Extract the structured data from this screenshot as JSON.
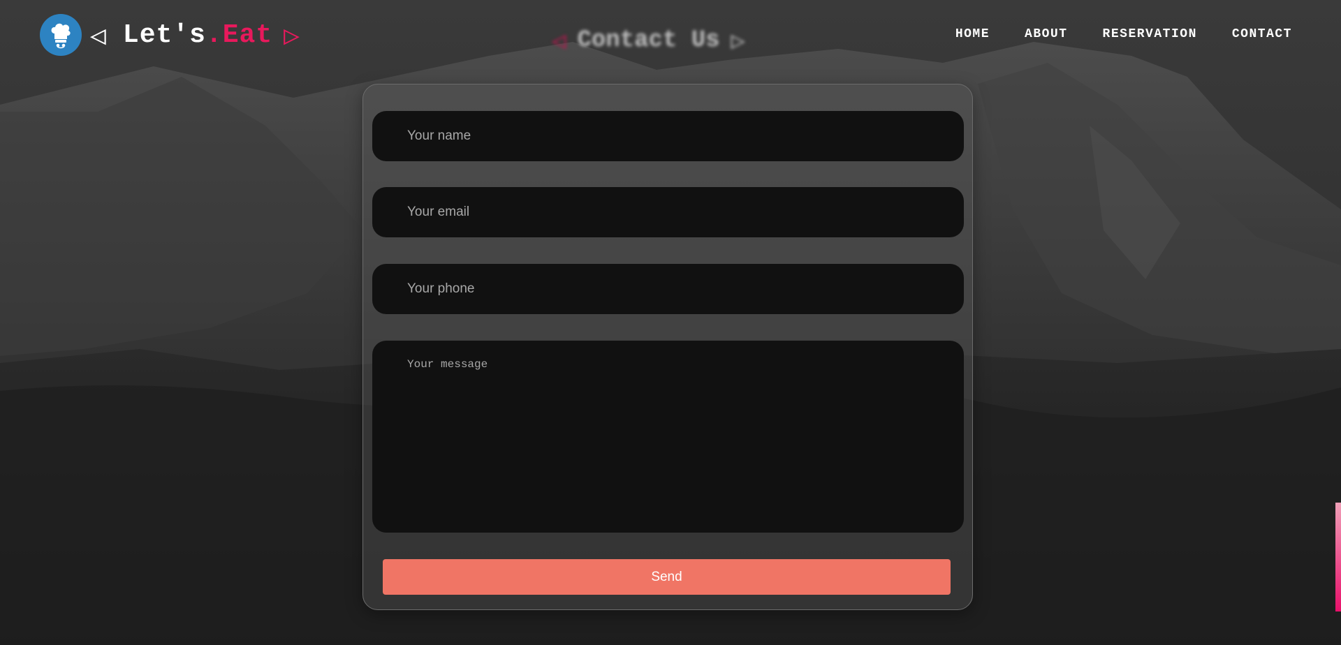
{
  "brand": {
    "arrow_left": "◁",
    "name": "Let's",
    "name_accent": ".Eat",
    "arrow_right": "▷",
    "logo_icon": "chef-hat-icon",
    "logo_color": "#2d83c2",
    "accent_color": "#e8195c"
  },
  "heading": {
    "arrow_left": "◁",
    "title": "Contact Us",
    "arrow_right": "▷"
  },
  "nav": {
    "items": [
      {
        "label": "HOME"
      },
      {
        "label": "ABOUT"
      },
      {
        "label": "RESERVATION"
      },
      {
        "label": "CONTACT"
      }
    ]
  },
  "form": {
    "name": {
      "placeholder": "Your name",
      "value": ""
    },
    "email": {
      "placeholder": "Your email",
      "value": ""
    },
    "phone": {
      "placeholder": "Your phone",
      "value": ""
    },
    "message": {
      "placeholder": "Your message",
      "value": ""
    },
    "send_label": "Send",
    "send_color": "#f07565"
  }
}
